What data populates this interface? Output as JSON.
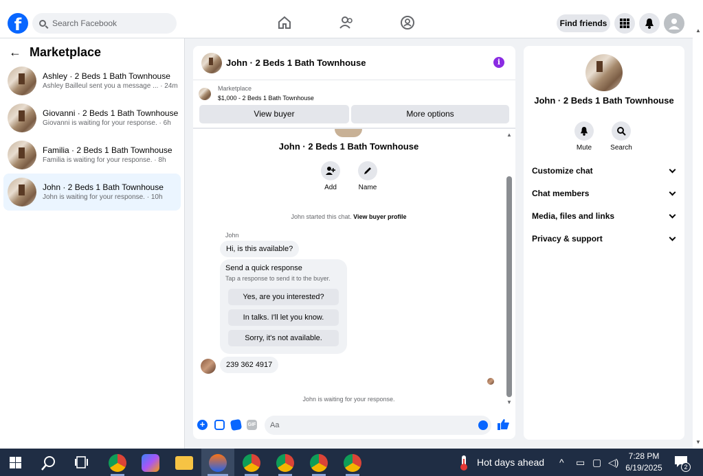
{
  "topbar": {
    "search_placeholder": "Search Facebook",
    "find_friends": "Find friends"
  },
  "left": {
    "title": "Marketplace",
    "conversations": [
      {
        "title": "Ashley · 2 Beds 1 Bath Townhouse",
        "preview": "Ashley Bailleul sent you a message ... · 24m"
      },
      {
        "title": "Giovanni · 2 Beds 1 Bath Townhouse",
        "preview": "Giovanni is waiting for your response. · 6h"
      },
      {
        "title": "Familia · 2 Beds 1 Bath Townhouse",
        "preview": "Familia is waiting for your response. · 8h"
      },
      {
        "title": "John · 2 Beds 1 Bath Townhouse",
        "preview": "John is waiting for your response. · 10h"
      }
    ]
  },
  "chat": {
    "title": "John · 2 Beds 1 Bath Townhouse",
    "marketplace_label": "Marketplace",
    "listing": "$1,000 - 2 Beds 1 Bath Townhouse",
    "view_buyer": "View buyer",
    "more_options": "More options",
    "profile_name": "John · 2 Beds 1 Bath Townhouse",
    "add_label": "Add",
    "name_label": "Name",
    "started_text": "John started this chat.",
    "view_buyer_profile": "View buyer profile",
    "sender": "John",
    "msg1": "Hi, is this available?",
    "quick_title": "Send a quick response",
    "quick_sub": "Tap a response to send it to the buyer.",
    "quick_replies": [
      "Yes, are you interested?",
      "In talks. I'll let you know.",
      "Sorry, it's not available."
    ],
    "msg2": "239 362 4917",
    "waiting": "John is waiting for your response.",
    "composer_placeholder": "Aa"
  },
  "right": {
    "name": "John · 2 Beds 1 Bath Townhouse",
    "mute": "Mute",
    "search": "Search",
    "sections": [
      "Customize chat",
      "Chat members",
      "Media, files and links",
      "Privacy & support"
    ]
  },
  "taskbar": {
    "weather": "Hot days ahead",
    "time": "7:28 PM",
    "date": "6/19/2025",
    "notif_count": "2"
  }
}
